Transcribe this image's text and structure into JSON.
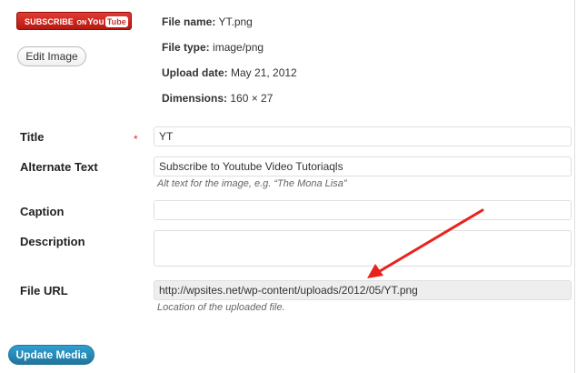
{
  "thumbnail": {
    "brand_text_1": "SUBSCRIBE",
    "brand_text_2": "ON",
    "brand_text_3": "You",
    "brand_text_4": "Tube"
  },
  "edit_image_label": "Edit Image",
  "file_info": {
    "name_label": "File name:",
    "name_value": "YT.png",
    "type_label": "File type:",
    "type_value": "image/png",
    "date_label": "Upload date:",
    "date_value": "May 21, 2012",
    "dims_label": "Dimensions:",
    "dims_value": "160 × 27"
  },
  "form": {
    "title_label": "Title",
    "required_marker": "*",
    "title_value": "YT",
    "alt_label": "Alternate Text",
    "alt_value": "Subscribe to Youtube Video Tutoriaqls",
    "alt_help": "Alt text for the image, e.g. “The Mona Lisa”",
    "caption_label": "Caption",
    "caption_value": "",
    "description_label": "Description",
    "description_value": "",
    "url_label": "File URL",
    "url_value": "http://wpsites.net/wp-content/uploads/2012/05/YT.png",
    "url_help": "Location of the uploaded file."
  },
  "update_label": "Update Media",
  "colors": {
    "accent": "#21759b",
    "required": "#e0292e",
    "arrow": "#e8231d",
    "youtube": "#c4302b"
  }
}
